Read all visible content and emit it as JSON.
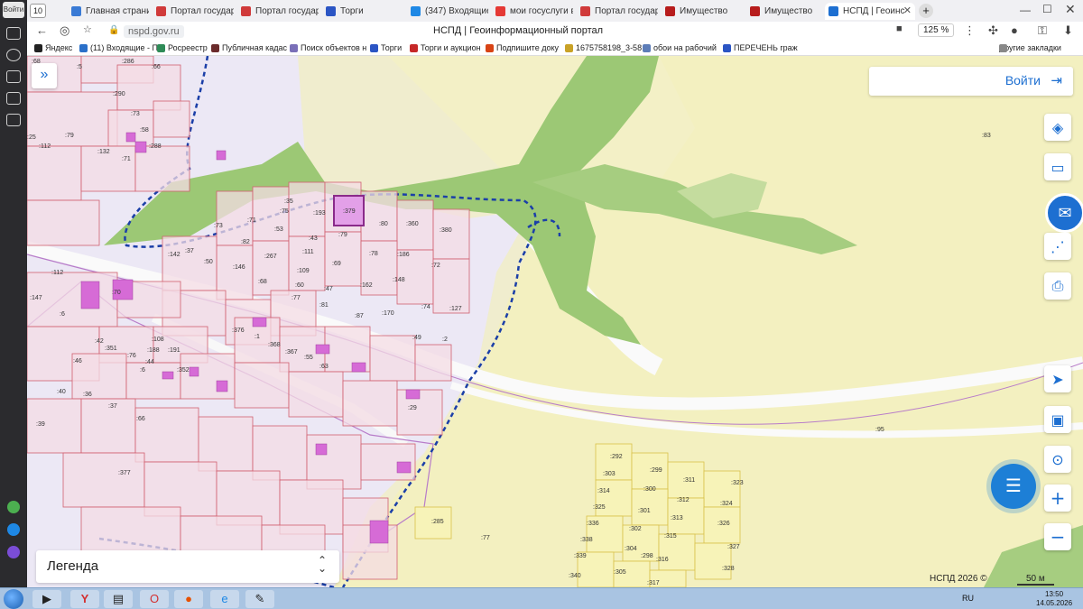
{
  "browser": {
    "tab_count": "10",
    "sidebar_login": "Войти",
    "tabs": [
      {
        "label": "Главная страниц",
        "color": "#3a7bd5"
      },
      {
        "label": "Портал государс",
        "color": "#d03a3a"
      },
      {
        "label": "Портал государс",
        "color": "#d03a3a"
      },
      {
        "label": "Торги",
        "color": "#2b55c4"
      },
      {
        "label": "(347) Входящие",
        "color": "#1e88e5"
      },
      {
        "label": "мои госуслуги в",
        "color": "#e53935"
      },
      {
        "label": "Портал государс",
        "color": "#d03a3a"
      },
      {
        "label": "Имущество",
        "color": "#b71c1c"
      },
      {
        "label": "Имущество",
        "color": "#b71c1c"
      },
      {
        "label": "НСПД | Геоинс",
        "color": "#1d6fd1",
        "active": true
      }
    ],
    "url": "nspd.gov.ru",
    "page_title": "НСПД | Геоинформационный портал",
    "zoom": "125 %",
    "bookmarks": [
      {
        "label": "Яндекс",
        "color": "#222"
      },
      {
        "label": "(11) Входящие - П",
        "color": "#2a70c9"
      },
      {
        "label": "Росреестр",
        "color": "#2e8b57"
      },
      {
        "label": "Публичная кадас",
        "color": "#6b2b2b"
      },
      {
        "label": "Поиск объектов н",
        "color": "#7a6fb8"
      },
      {
        "label": "Торги",
        "color": "#2b55c4"
      },
      {
        "label": "Торги и аукцион",
        "color": "#c62828"
      },
      {
        "label": "Подпишите доку",
        "color": "#d84315"
      },
      {
        "label": "1675758198_3-58",
        "color": "#c9a227"
      },
      {
        "label": "обои на рабочий",
        "color": "#5d7db8"
      },
      {
        "label": "ПЕРЕЧЕНЬ граж",
        "color": "#2b55c4"
      }
    ],
    "other_bookmarks": "Другие закладки"
  },
  "map": {
    "login_label": "Войти",
    "legend_label": "Легенда",
    "copyright": "НСПД 2026 ©",
    "scale_label": "50 м",
    "plot_labels": [
      {
        "t": ":68"
      },
      {
        "t": ":5"
      },
      {
        "t": ":286"
      },
      {
        "t": ":66"
      },
      {
        "t": ":290"
      },
      {
        "t": ":73"
      },
      {
        "t": ":58"
      },
      {
        "t": ":288"
      },
      {
        "t": ":112"
      },
      {
        "t": ":79"
      },
      {
        "t": ":132"
      },
      {
        "t": ":71"
      },
      {
        "t": ":25"
      },
      {
        "t": ":35"
      },
      {
        "t": ":75"
      },
      {
        "t": ":193"
      },
      {
        "t": ":379"
      },
      {
        "t": ":80"
      },
      {
        "t": ":360"
      },
      {
        "t": ":380"
      },
      {
        "t": ":71"
      },
      {
        "t": ":73"
      },
      {
        "t": ":53"
      },
      {
        "t": ":43"
      },
      {
        "t": ":79"
      },
      {
        "t": ":82"
      },
      {
        "t": ":267"
      },
      {
        "t": ":111"
      },
      {
        "t": ":78"
      },
      {
        "t": ":186"
      },
      {
        "t": ":142"
      },
      {
        "t": ":37"
      },
      {
        "t": ":50"
      },
      {
        "t": ":146"
      },
      {
        "t": ":69"
      },
      {
        "t": ":72"
      },
      {
        "t": ":109"
      },
      {
        "t": ":148"
      },
      {
        "t": ":68"
      },
      {
        "t": ":60"
      },
      {
        "t": ":47"
      },
      {
        "t": ":162"
      },
      {
        "t": ":77"
      },
      {
        "t": ":81"
      },
      {
        "t": ":112"
      },
      {
        "t": ":147"
      },
      {
        "t": ":70"
      },
      {
        "t": ":6"
      },
      {
        "t": ":74"
      },
      {
        "t": ":127"
      },
      {
        "t": ":87"
      },
      {
        "t": ":170"
      },
      {
        "t": ":376"
      },
      {
        "t": ":1"
      },
      {
        "t": ":49"
      },
      {
        "t": ":2"
      },
      {
        "t": ":42"
      },
      {
        "t": ":351"
      },
      {
        "t": ":108"
      },
      {
        "t": ":188"
      },
      {
        "t": ":191"
      },
      {
        "t": ":368"
      },
      {
        "t": ":367"
      },
      {
        "t": ":76"
      },
      {
        "t": ":44"
      },
      {
        "t": ":55"
      },
      {
        "t": ":46"
      },
      {
        "t": ":6"
      },
      {
        "t": ":352"
      },
      {
        "t": ":63"
      },
      {
        "t": ":40"
      },
      {
        "t": ":36"
      },
      {
        "t": ":29"
      },
      {
        "t": ":37"
      },
      {
        "t": ":66"
      },
      {
        "t": ":39"
      },
      {
        "t": ":377"
      },
      {
        "t": ":83"
      },
      {
        "t": ":95"
      },
      {
        "t": ":292"
      },
      {
        "t": ":303"
      },
      {
        "t": ":299"
      },
      {
        "t": ":311"
      },
      {
        "t": ":323"
      },
      {
        "t": ":314"
      },
      {
        "t": ":300"
      },
      {
        "t": ":312"
      },
      {
        "t": ":324"
      },
      {
        "t": ":325"
      },
      {
        "t": ":301"
      },
      {
        "t": ":313"
      },
      {
        "t": ":326"
      },
      {
        "t": ":336"
      },
      {
        "t": ":302"
      },
      {
        "t": ":315"
      },
      {
        "t": ":327"
      },
      {
        "t": ":338"
      },
      {
        "t": ":304"
      },
      {
        "t": ":298"
      },
      {
        "t": ":316"
      },
      {
        "t": ":328"
      },
      {
        "t": ":339"
      },
      {
        "t": ":305"
      },
      {
        "t": ":317"
      },
      {
        "t": ":340"
      },
      {
        "t": ":285"
      },
      {
        "t": ":77"
      }
    ]
  },
  "taskbar": {
    "lang": "RU",
    "time": "13:50",
    "date": "14.05.2026"
  }
}
